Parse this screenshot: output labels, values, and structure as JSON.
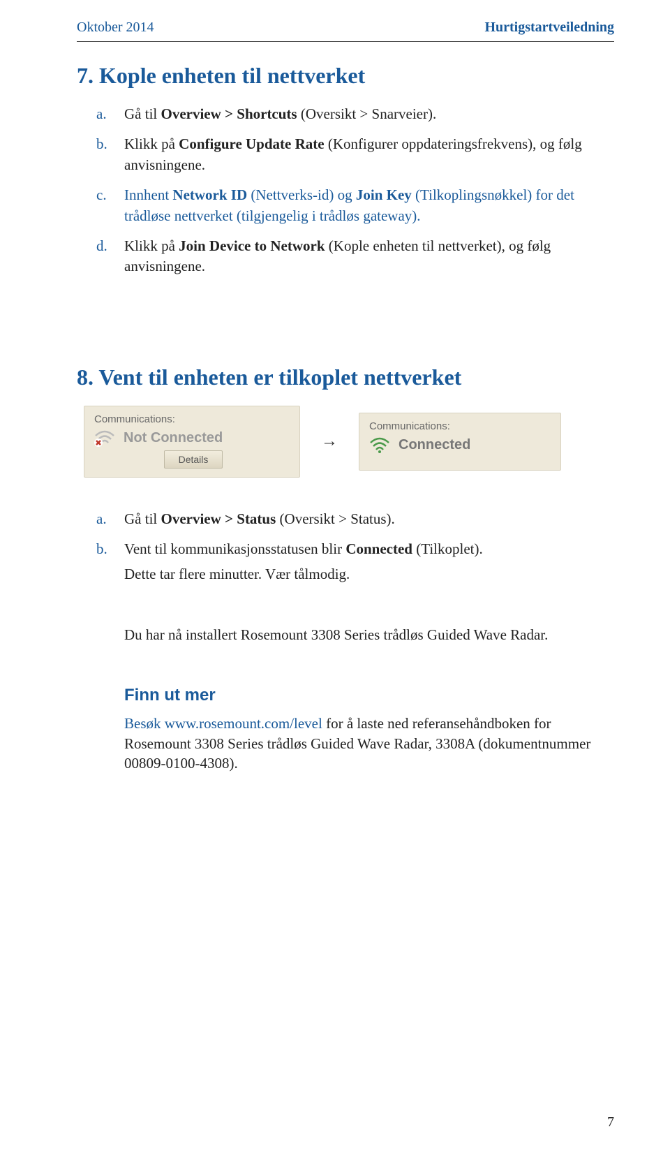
{
  "header": {
    "date": "Oktober 2014",
    "guide": "Hurtigstartveiledning"
  },
  "section7": {
    "title": "7. Kople enheten til nettverket",
    "items": {
      "a": {
        "pre": "Gå til ",
        "bold": "Overview > Shortcuts",
        "post": " (Oversikt > Snarveier)."
      },
      "b": {
        "pre": "Klikk på ",
        "bold": "Configure Update Rate",
        "post": " (Konfigurer oppdateringsfrekvens), og følg anvisningene."
      },
      "c": {
        "pre": "Innhent ",
        "bold1": "Network ID",
        "mid1": " (Nettverks-id) og ",
        "bold2": "Join Key",
        "mid2": " (Tilkoplingsnøkkel) for det trådløse nettverket (tilgjengelig i trådløs gateway)."
      },
      "d": {
        "pre": "Klikk på ",
        "bold": "Join Device to Network",
        "post": " (Kople enheten til nettverket), og følg anvisningene."
      }
    }
  },
  "section8": {
    "title": "8. Vent til enheten er tilkoplet nettverket",
    "status_label": "Communications:",
    "not_connected": "Not Connected",
    "details_btn": "Details",
    "connected": "Connected",
    "items": {
      "a": {
        "pre": "Gå til ",
        "bold": "Overview > Status",
        "post": " (Oversikt > Status)."
      },
      "b": {
        "pre": "Vent til kommunikasjonsstatusen blir ",
        "bold": "Connected",
        "post": " (Tilkoplet)."
      },
      "note": "Dette tar flere minutter. Vær tålmodig."
    },
    "install_done": "Du har nå installert Rosemount 3308 Series trådløs Guided Wave Radar."
  },
  "findmore": {
    "title": "Finn ut mer",
    "pre": "Besøk ",
    "link": "www.rosemount.com/level",
    "post": " for å laste ned referansehåndboken for Rosemount 3308 Series trådløs Guided Wave Radar, 3308A (dokumentnummer 00809-0100-4308)."
  },
  "page_number": "7"
}
